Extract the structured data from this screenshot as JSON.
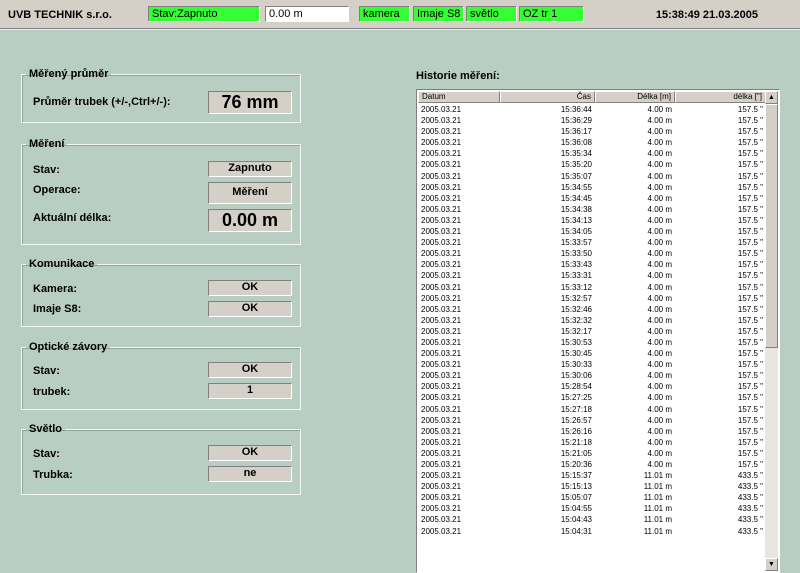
{
  "topbar": {
    "brand": "UVB TECHNIK s.r.o.",
    "status": "Stav:Zapnuto",
    "length": "0.00 m",
    "camera": "kamera",
    "imaje": "Imaje S8",
    "light": "světlo",
    "oz": "OZ tr 1",
    "datetime": "15:38:49 21.03.2005"
  },
  "diameter": {
    "legend": "Měřený průměr",
    "label": "Průměr trubek (+/-,Ctrl+/-):",
    "value": "76 mm"
  },
  "measurement": {
    "legend": "Měření",
    "state_label": "Stav:",
    "state_value": "Zapnuto",
    "operation_label": "Operace:",
    "operation_value": "Měření",
    "length_label": "Aktuální délka:",
    "length_value": "0.00 m"
  },
  "communication": {
    "legend": "Komunikace",
    "camera_label": "Kamera:",
    "camera_value": "OK",
    "imaje_label": "Imaje S8:",
    "imaje_value": "OK"
  },
  "optical": {
    "legend": "Optické závory",
    "state_label": "Stav:",
    "state_value": "OK",
    "tubes_label": "trubek:",
    "tubes_value": "1"
  },
  "light": {
    "legend": "Světlo",
    "state_label": "Stav:",
    "state_value": "OK",
    "tube_label": "Trubka:",
    "tube_value": "ne"
  },
  "history": {
    "title": "Historie měření:",
    "columns": [
      "Datum",
      "Čas",
      "Délka [m]",
      "délka [\"]"
    ],
    "rows": [
      [
        "2005.03.21",
        "15:36:44",
        "4.00 m",
        "157.5 \""
      ],
      [
        "2005.03.21",
        "15:36:29",
        "4.00 m",
        "157.5 \""
      ],
      [
        "2005.03.21",
        "15:36:17",
        "4.00 m",
        "157.5 \""
      ],
      [
        "2005.03.21",
        "15:36:08",
        "4.00 m",
        "157.5 \""
      ],
      [
        "2005.03.21",
        "15:35:34",
        "4.00 m",
        "157.5 \""
      ],
      [
        "2005.03.21",
        "15:35:20",
        "4.00 m",
        "157.5 \""
      ],
      [
        "2005.03.21",
        "15:35:07",
        "4.00 m",
        "157.5 \""
      ],
      [
        "2005.03.21",
        "15:34:55",
        "4.00 m",
        "157.5 \""
      ],
      [
        "2005.03.21",
        "15:34:45",
        "4.00 m",
        "157.5 \""
      ],
      [
        "2005.03.21",
        "15:34:38",
        "4.00 m",
        "157.5 \""
      ],
      [
        "2005.03.21",
        "15:34:13",
        "4.00 m",
        "157.5 \""
      ],
      [
        "2005.03.21",
        "15:34:05",
        "4.00 m",
        "157.5 \""
      ],
      [
        "2005.03.21",
        "15:33:57",
        "4.00 m",
        "157.5 \""
      ],
      [
        "2005.03.21",
        "15:33:50",
        "4.00 m",
        "157.5 \""
      ],
      [
        "2005.03.21",
        "15:33:43",
        "4.00 m",
        "157.5 \""
      ],
      [
        "2005.03.21",
        "15:33:31",
        "4.00 m",
        "157.5 \""
      ],
      [
        "2005.03.21",
        "15:33:12",
        "4.00 m",
        "157.5 \""
      ],
      [
        "2005.03.21",
        "15:32:57",
        "4.00 m",
        "157.5 \""
      ],
      [
        "2005.03.21",
        "15:32:46",
        "4.00 m",
        "157.5 \""
      ],
      [
        "2005.03.21",
        "15:32:32",
        "4.00 m",
        "157.5 \""
      ],
      [
        "2005.03.21",
        "15:32:17",
        "4.00 m",
        "157.5 \""
      ],
      [
        "2005.03.21",
        "15:30:53",
        "4.00 m",
        "157.5 \""
      ],
      [
        "2005.03.21",
        "15:30:45",
        "4.00 m",
        "157.5 \""
      ],
      [
        "2005.03.21",
        "15:30:33",
        "4.00 m",
        "157.5 \""
      ],
      [
        "2005.03.21",
        "15:30:06",
        "4.00 m",
        "157.5 \""
      ],
      [
        "2005.03.21",
        "15:28:54",
        "4.00 m",
        "157.5 \""
      ],
      [
        "2005.03.21",
        "15:27:25",
        "4.00 m",
        "157.5 \""
      ],
      [
        "2005.03.21",
        "15:27:18",
        "4.00 m",
        "157.5 \""
      ],
      [
        "2005.03.21",
        "15:26:57",
        "4.00 m",
        "157.5 \""
      ],
      [
        "2005.03.21",
        "15:26:16",
        "4.00 m",
        "157.5 \""
      ],
      [
        "2005.03.21",
        "15:21:18",
        "4.00 m",
        "157.5 \""
      ],
      [
        "2005.03.21",
        "15:21:05",
        "4.00 m",
        "157.5 \""
      ],
      [
        "2005.03.21",
        "15:20:36",
        "4.00 m",
        "157.5 \""
      ],
      [
        "2005.03.21",
        "15:15:37",
        "11.01 m",
        "433.5 \""
      ],
      [
        "2005.03.21",
        "15:15:13",
        "11.01 m",
        "433.5 \""
      ],
      [
        "2005.03.21",
        "15:05:07",
        "11.01 m",
        "433.5 \""
      ],
      [
        "2005.03.21",
        "15:04:55",
        "11.01 m",
        "433.5 \""
      ],
      [
        "2005.03.21",
        "15:04:43",
        "11.01 m",
        "433.5 \""
      ],
      [
        "2005.03.21",
        "15:04:31",
        "11.01 m",
        "433.5 \""
      ]
    ]
  },
  "scrollbar": {
    "up_glyph": "▲",
    "down_glyph": "▼"
  }
}
